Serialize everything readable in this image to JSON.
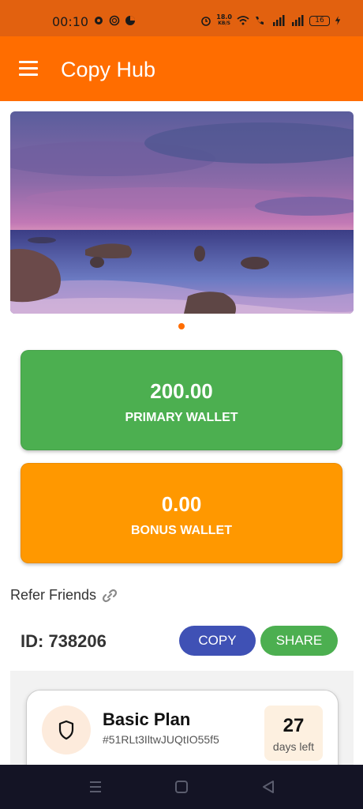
{
  "status_bar": {
    "time": "00:10",
    "net_speed_value": "18.0",
    "net_speed_unit": "KB/S",
    "battery": "16",
    "icons": [
      "settings-icon",
      "chatgpt-icon",
      "pie-app-icon",
      "alarm-icon",
      "wifi-icon",
      "volte-call-icon",
      "signal-icon",
      "signal-icon",
      "battery-icon",
      "charging-icon"
    ]
  },
  "app_bar": {
    "title": "Copy Hub",
    "menu_icon": "hamburger-menu-icon"
  },
  "banner": {
    "description_icon": "seascape-sunset-image",
    "active_slide": 1,
    "slide_count": 1
  },
  "wallets": {
    "primary": {
      "amount": "200.00",
      "label": "PRIMARY WALLET",
      "color": "#4caf50"
    },
    "bonus": {
      "amount": "0.00",
      "label": "BONUS WALLET",
      "color": "#ff9800"
    }
  },
  "referral": {
    "title": "Refer Friends",
    "icon": "link-icon",
    "id_text": "ID: 738206",
    "copy_label": "COPY",
    "share_label": "SHARE"
  },
  "plan": {
    "name": "Basic Plan",
    "code": "#51RLt3IltwJUQtIO55f5",
    "days_number": "27",
    "days_label": "days left",
    "icon": "shield-icon"
  },
  "colors": {
    "accent": "#ff6d00",
    "status_bar": "#e2610f",
    "copy_button": "#3f51b5",
    "share_button": "#4caf50",
    "nav_bar": "#141425"
  },
  "nav_bar": {
    "icons": [
      "recents-icon",
      "home-icon",
      "back-icon"
    ]
  }
}
